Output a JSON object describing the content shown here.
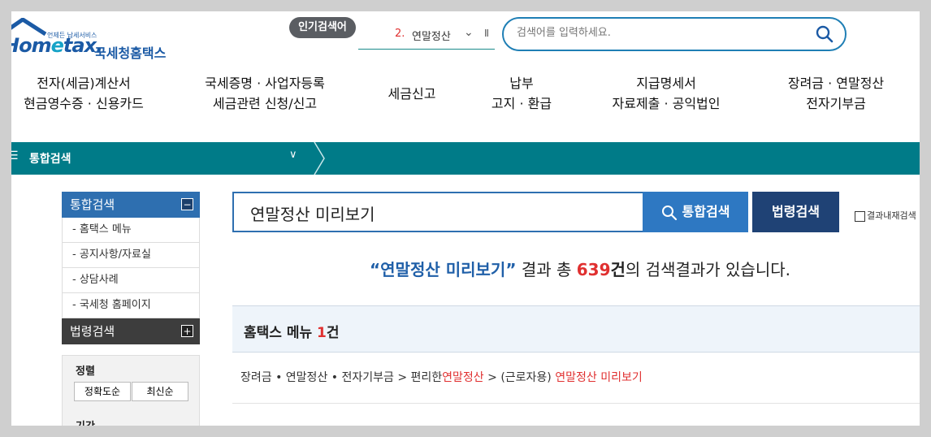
{
  "logo": {
    "tagline": "언제든 납세서비스",
    "brand_prefix": "Hom",
    "brand_e": "e",
    "brand_suffix": "tax.",
    "korean_name": "국세청홈택스"
  },
  "popular": {
    "badge": "인기검색어",
    "rank": "2.",
    "term": "연말정산",
    "chevron_icon": "chevron-down-icon",
    "pause_icon": "pause-icon"
  },
  "top_search": {
    "placeholder": "검색어를 입력하세요.",
    "icon": "search-icon"
  },
  "gnb": [
    {
      "line1": "전자(세금)계산서",
      "line2": "현금영수증 · 신용카드"
    },
    {
      "line1": "국세증명 · 사업자등록",
      "line2": "세금관련 신청/신고"
    },
    {
      "line1": "세금신고",
      "line2": ""
    },
    {
      "line1": "납부",
      "line2": "고지 · 환급"
    },
    {
      "line1": "지급명세서",
      "line2": "자료제출 · 공익법인"
    },
    {
      "line1": "장려금 · 연말정산",
      "line2": "전자기부금"
    }
  ],
  "navbar": {
    "title": "통합검색",
    "menu_icon": "hamburger-icon"
  },
  "sidebar": {
    "section1": {
      "title": "통합검색",
      "toggle": "−"
    },
    "items": [
      "- 홈택스 메뉴",
      "- 공지사항/자료실",
      "- 상담사례",
      "- 국세청 홈페이지"
    ],
    "section2": {
      "title": "법령검색",
      "toggle": "+"
    }
  },
  "filter": {
    "sort_label": "정렬",
    "sort_accuracy": "정확도순",
    "sort_latest": "최신순",
    "period_label": "기간"
  },
  "main_search": {
    "value": "연말정산 미리보기",
    "btn_total": "통합검색",
    "btn_law": "법령검색",
    "within_label": "결과내재검색"
  },
  "summary": {
    "query": "“연말정산 미리보기”",
    "text1": " 결과 총 ",
    "count": "639",
    "unit": "건",
    "text2": "의 검색결과가 있습니다."
  },
  "section": {
    "title": "홈택스 메뉴 ",
    "count": "1",
    "unit": "건"
  },
  "result": {
    "path": "장려금 • 연말정산 • 전자기부금 > 편리한",
    "hl1": "연말정산",
    "mid": " > (근로자용) ",
    "hl2": "연말정산 미리보기"
  },
  "colors": {
    "teal": "#007b88",
    "blue": "#2e6fb0",
    "navy": "#1f4275",
    "red": "#e03030"
  }
}
